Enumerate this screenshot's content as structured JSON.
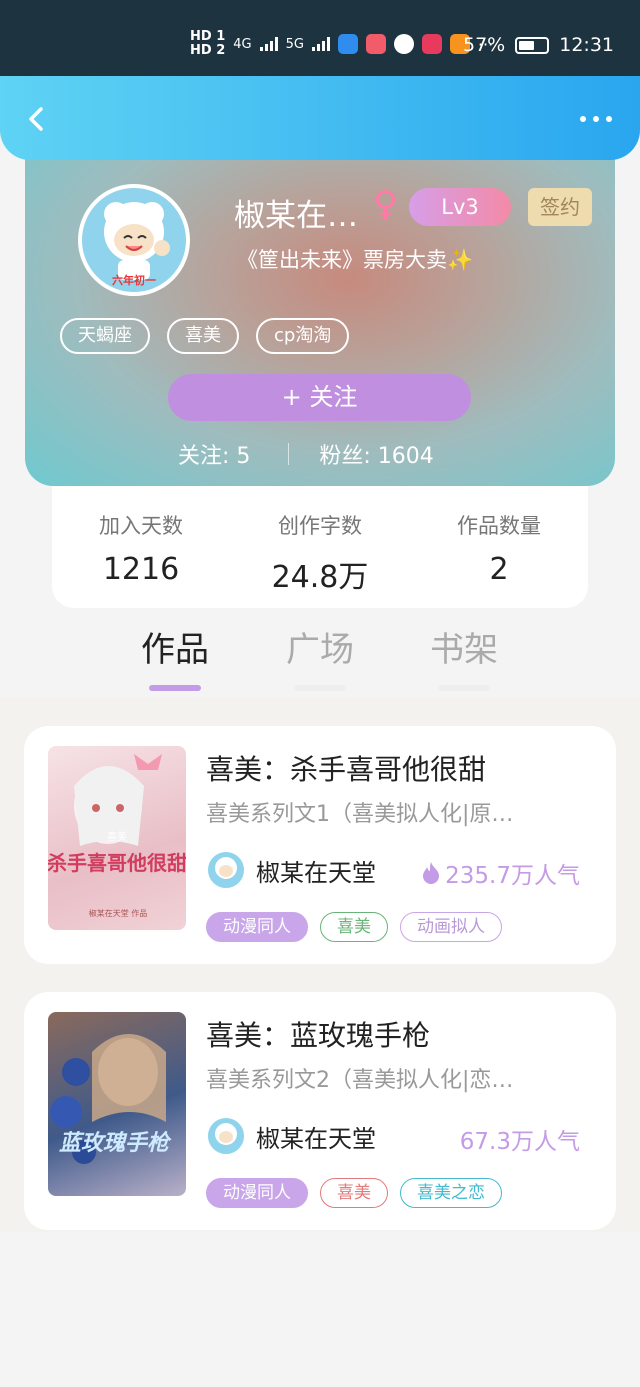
{
  "status_bar": {
    "network_labels": [
      "HD 1",
      "HD 2",
      "4G",
      "5G"
    ],
    "battery": "57%",
    "battery_level": 0.57,
    "time": "12:31"
  },
  "nav": {
    "back_icon": "chevron-left-icon",
    "more_icon": "more-dots-icon"
  },
  "profile": {
    "name": "椒某在…",
    "gender_symbol": "♀",
    "level": "Lv3",
    "signed_badge": "签约",
    "motto": "《筐出未来》票房大卖✨",
    "avatar_caption": "六年初一",
    "tags": [
      "天蝎座",
      "喜美",
      "cp淘淘"
    ],
    "follow_button": "+  关注",
    "following_label": "关注: 5",
    "followers_label": "粉丝: 1604"
  },
  "stats": [
    {
      "label": "加入天数",
      "value": "1216"
    },
    {
      "label": "创作字数",
      "value": "24.8万"
    },
    {
      "label": "作品数量",
      "value": "2"
    }
  ],
  "tabs": [
    "作品",
    "广场",
    "书架"
  ],
  "books": [
    {
      "title": "喜美：杀手喜哥他很甜",
      "desc": "喜美系列文1（喜美拟人化|原…",
      "author": "椒某在天堂",
      "popularity": "235.7万人气",
      "cover_text": "杀手喜哥他很甜",
      "cover_badge": "喜美",
      "cover_author": "椒某在天堂 作品",
      "tags": [
        {
          "label": "动漫同人",
          "style": "fill",
          "color": "#c9a5ea"
        },
        {
          "label": "喜美",
          "style": "outline",
          "color": "#6ab47a"
        },
        {
          "label": "动画拟人",
          "style": "outline",
          "color": "#c9a5ea"
        }
      ]
    },
    {
      "title": "喜美：蓝玫瑰手枪",
      "desc": "喜美系列文2（喜美拟人化|恋…",
      "author": "椒某在天堂",
      "popularity": "67.3万人气",
      "cover_text": "蓝玫瑰手枪",
      "tags": [
        {
          "label": "动漫同人",
          "style": "fill",
          "color": "#c9a5ea"
        },
        {
          "label": "喜美",
          "style": "outline",
          "color": "#e27b7b"
        },
        {
          "label": "喜美之恋",
          "style": "outline",
          "color": "#45b9cf"
        }
      ]
    }
  ],
  "colors": {
    "accent": "#c49be6",
    "nav_blue": "#29a6ef"
  }
}
